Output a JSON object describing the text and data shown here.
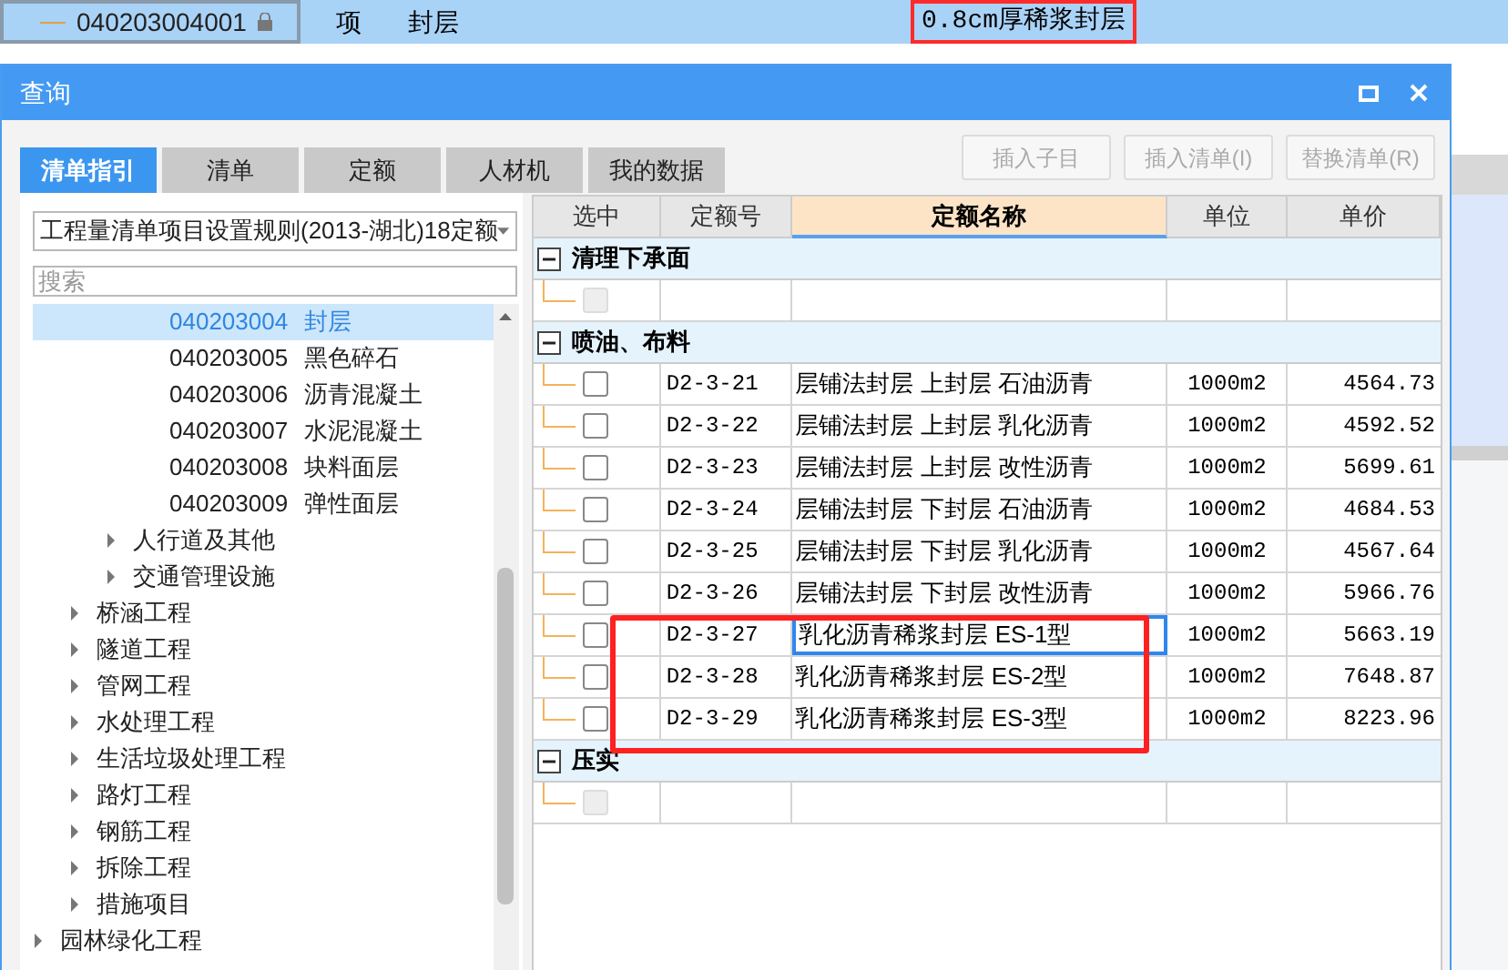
{
  "background_row": {
    "code": "040203004001",
    "locked": true,
    "type": "项",
    "name": "封层",
    "description": "0.8cm厚稀浆封层"
  },
  "dialog": {
    "title": "查询",
    "tabs": [
      {
        "label": "清单指引",
        "selected": true
      },
      {
        "label": "清单",
        "selected": false
      },
      {
        "label": "定额",
        "selected": false
      },
      {
        "label": "人材机",
        "selected": false
      },
      {
        "label": "我的数据",
        "selected": false
      }
    ],
    "buttons": [
      {
        "label": "插入子目",
        "disabled": true
      },
      {
        "label": "插入清单(I)",
        "disabled": true
      },
      {
        "label": "替换清单(R)",
        "disabled": true
      }
    ],
    "library": "工程量清单项目设置规则(2013-湖北)18定额",
    "search": {
      "placeholder": "搜索"
    },
    "tree": [
      {
        "children": [
          {
            "children": [
              {
                "children": [
                  {
                    "code": "040203004",
                    "label": "封层",
                    "selected": true
                  },
                  {
                    "code": "040203005",
                    "label": "黑色碎石",
                    "selected": false
                  },
                  {
                    "code": "040203006",
                    "label": "沥青混凝土",
                    "selected": false
                  },
                  {
                    "code": "040203007",
                    "label": "水泥混凝土",
                    "selected": false
                  },
                  {
                    "code": "040203008",
                    "label": "块料面层",
                    "selected": false
                  },
                  {
                    "code": "040203009",
                    "label": "弹性面层",
                    "selected": false
                  }
                ]
              },
              {
                "label": "人行道及其他",
                "expanded": false
              },
              {
                "label": "交通管理设施",
                "expanded": false
              }
            ]
          },
          {
            "label": "桥涵工程",
            "expanded": false
          },
          {
            "label": "隧道工程",
            "expanded": false
          },
          {
            "label": "管网工程",
            "expanded": false
          },
          {
            "label": "水处理工程",
            "expanded": false
          },
          {
            "label": "生活垃圾处理工程",
            "expanded": false
          },
          {
            "label": "路灯工程",
            "expanded": false
          },
          {
            "label": "钢筋工程",
            "expanded": false
          },
          {
            "label": "拆除工程",
            "expanded": false
          },
          {
            "label": "措施项目",
            "expanded": false
          }
        ]
      },
      {
        "label": "园林绿化工程",
        "expanded": false
      }
    ],
    "table": {
      "columns": [
        {
          "label": "选中",
          "selected": false
        },
        {
          "label": "定额号",
          "selected": false
        },
        {
          "label": "定额名称",
          "selected": true
        },
        {
          "label": "单位",
          "selected": false
        },
        {
          "label": "单价",
          "selected": false
        }
      ],
      "groups": [
        {
          "title": "清理下承面",
          "expanded": true,
          "rows": [
            {
              "kind": "blank",
              "checked": false
            }
          ]
        },
        {
          "title": "喷油、布料",
          "expanded": true,
          "rows": [
            {
              "kind": "item",
              "checked": false,
              "code": "D2-3-21",
              "name": "层铺法封层 上封层 石油沥青",
              "unit": "1000m2",
              "price": "4564.73",
              "focused": false
            },
            {
              "kind": "item",
              "checked": false,
              "code": "D2-3-22",
              "name": "层铺法封层 上封层 乳化沥青",
              "unit": "1000m2",
              "price": "4592.52",
              "focused": false
            },
            {
              "kind": "item",
              "checked": false,
              "code": "D2-3-23",
              "name": "层铺法封层 上封层 改性沥青",
              "unit": "1000m2",
              "price": "5699.61",
              "focused": false
            },
            {
              "kind": "item",
              "checked": false,
              "code": "D2-3-24",
              "name": "层铺法封层 下封层 石油沥青",
              "unit": "1000m2",
              "price": "4684.53",
              "focused": false
            },
            {
              "kind": "item",
              "checked": false,
              "code": "D2-3-25",
              "name": "层铺法封层 下封层 乳化沥青",
              "unit": "1000m2",
              "price": "4567.64",
              "focused": false
            },
            {
              "kind": "item",
              "checked": false,
              "code": "D2-3-26",
              "name": "层铺法封层 下封层 改性沥青",
              "unit": "1000m2",
              "price": "5966.76",
              "focused": false
            },
            {
              "kind": "item",
              "checked": false,
              "code": "D2-3-27",
              "name": "乳化沥青稀浆封层 ES-1型",
              "unit": "1000m2",
              "price": "5663.19",
              "focused": true
            },
            {
              "kind": "item",
              "checked": false,
              "code": "D2-3-28",
              "name": "乳化沥青稀浆封层 ES-2型",
              "unit": "1000m2",
              "price": "7648.87",
              "focused": false
            },
            {
              "kind": "item",
              "checked": false,
              "code": "D2-3-29",
              "name": "乳化沥青稀浆封层 ES-3型",
              "unit": "1000m2",
              "price": "8223.96",
              "focused": false
            }
          ]
        },
        {
          "title": "压实",
          "expanded": true,
          "rows": [
            {
              "kind": "blank",
              "checked": false
            }
          ]
        }
      ]
    }
  }
}
